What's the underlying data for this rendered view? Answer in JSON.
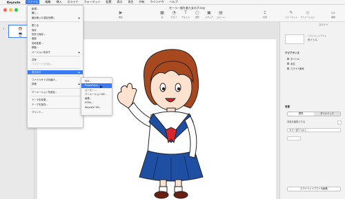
{
  "menubar": {
    "app_name": "Keynote",
    "items": [
      "ファイル",
      "編集",
      "挿入",
      "スライド",
      "フォーマット",
      "配置",
      "表示",
      "再生",
      "共有",
      "ウインドウ",
      "ヘルプ"
    ]
  },
  "window": {
    "title": "セーラー服を着た女の子.key"
  },
  "toolbar": {
    "buttons": [
      {
        "label": "再生",
        "icon": "play-icon"
      },
      {
        "label": "表",
        "icon": "table-icon"
      },
      {
        "label": "グラフ",
        "icon": "chart-icon"
      },
      {
        "label": "テキスト",
        "icon": "text-icon"
      },
      {
        "label": "図形",
        "icon": "shape-icon"
      },
      {
        "label": "メディア",
        "icon": "media-icon"
      },
      {
        "label": "コメント",
        "icon": "comment-icon"
      },
      {
        "label": "共有",
        "icon": "share-icon"
      },
      {
        "label": "フォーマット",
        "icon": "format-icon"
      },
      {
        "label": "アニメーション",
        "icon": "animation-icon"
      },
      {
        "label": "書類",
        "icon": "document-icon"
      }
    ]
  },
  "navigator": {
    "slide_number": "1"
  },
  "inspector": {
    "tab": "スライド",
    "layout_label": "スライドレイアウト",
    "layout_value": "タイトル",
    "appearance_title": "アピアランス",
    "checkboxes": [
      "タイトル",
      "本文",
      "スライド番号"
    ],
    "background_title": "背景",
    "seg_standard": "標準",
    "seg_dynamic": "ダイナミック",
    "bg_label": "背景を編集できる",
    "fill_value": "カラー塗りつぶし",
    "bottom_button": "スライドレイアウトを編集"
  },
  "file_menu": {
    "items": [
      {
        "label": "新規...",
        "disabled": false
      },
      {
        "label": "開く...",
        "disabled": false
      },
      {
        "label": "最近使った項目を開く",
        "disabled": false,
        "submenu": true
      },
      {
        "sep": true
      },
      {
        "label": "閉じる",
        "disabled": false
      },
      {
        "label": "保存",
        "disabled": false
      },
      {
        "label": "別名で保存...",
        "disabled": false
      },
      {
        "label": "複製",
        "disabled": false
      },
      {
        "label": "名称変更...",
        "disabled": false
      },
      {
        "label": "移動...",
        "disabled": false
      },
      {
        "label": "バージョンを戻す",
        "disabled": false,
        "submenu": true
      },
      {
        "sep": true
      },
      {
        "label": "共有",
        "disabled": false
      },
      {
        "label": "パスワードを設定...",
        "disabled": true
      },
      {
        "sep": true
      },
      {
        "label": "書き出す",
        "disabled": false,
        "submenu": true,
        "highlight": true
      },
      {
        "sep": true
      },
      {
        "label": "ファイルサイズを縮小...",
        "disabled": false
      },
      {
        "label": "詳細",
        "disabled": false,
        "submenu": true
      },
      {
        "sep": true
      },
      {
        "label": "アニメーションを設定...",
        "disabled": false
      },
      {
        "sep": true
      },
      {
        "label": "テーマを変更...",
        "disabled": false
      },
      {
        "label": "テーマを保存...",
        "disabled": false
      },
      {
        "sep": true
      },
      {
        "label": "プリント...",
        "disabled": false
      }
    ]
  },
  "export_submenu": {
    "items": [
      {
        "label": "PDF...",
        "highlight": false
      },
      {
        "label": "PowerPoint...",
        "highlight": true
      },
      {
        "label": "ムービー...",
        "highlight": false
      },
      {
        "label": "アニメーションGIF...",
        "highlight": false
      },
      {
        "label": "画像...",
        "highlight": false
      },
      {
        "label": "HTML...",
        "highlight": false
      },
      {
        "label": "Keynote '09...",
        "highlight": false
      }
    ]
  },
  "colors": {
    "accent": "#3a7cf5",
    "hair": "#a8481f",
    "skirt": "#1f4fa3",
    "scarf": "#d8262e",
    "skin": "#fde3cf"
  }
}
